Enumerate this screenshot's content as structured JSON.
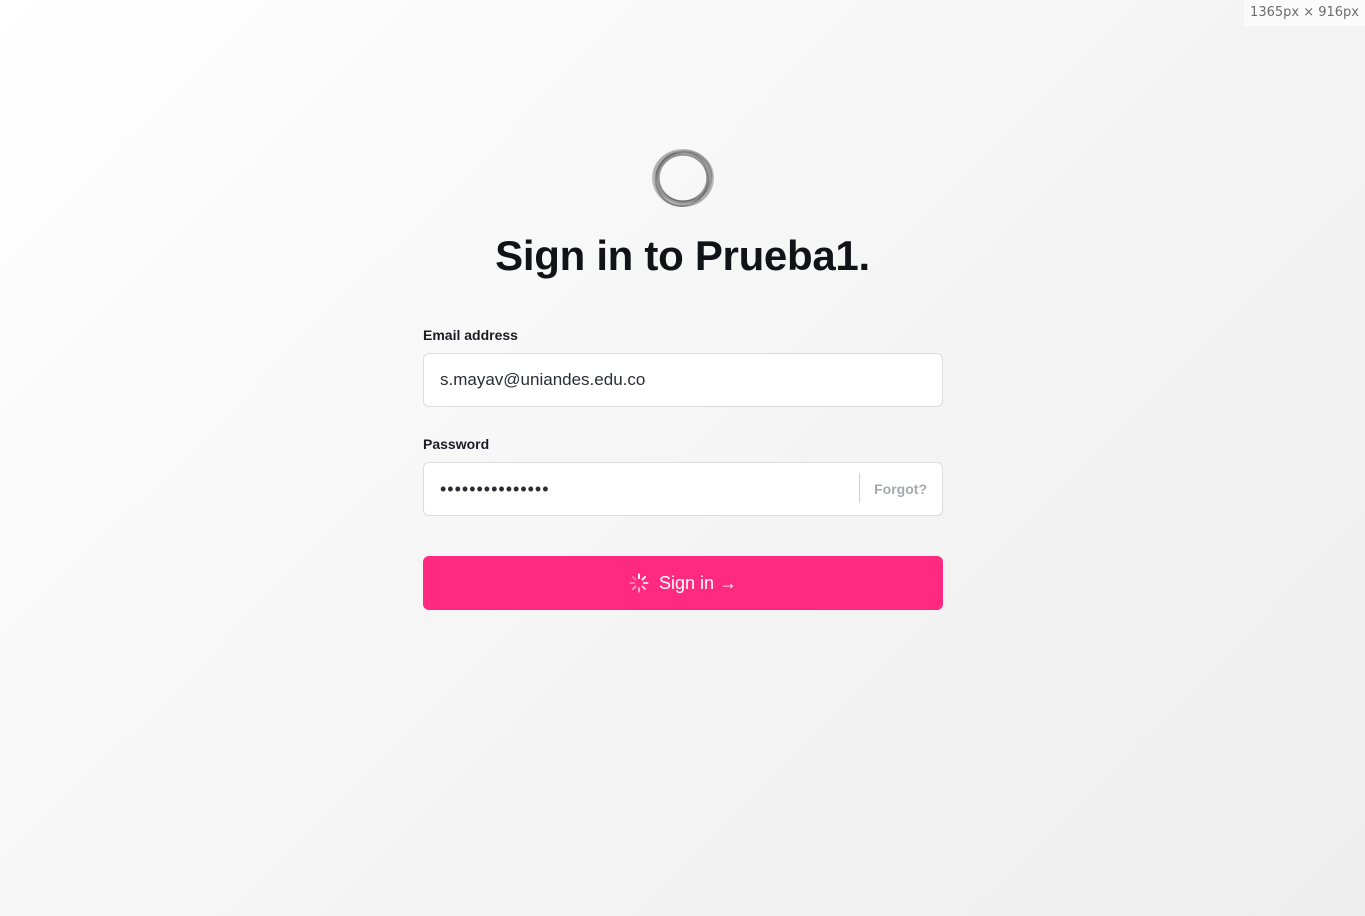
{
  "viewport_indicator": "1365px × 916px",
  "logo": {
    "icon": "ring-logo-icon"
  },
  "title": "Sign in to Prueba1.",
  "form": {
    "email": {
      "label": "Email address",
      "value": "s.mayav@uniandes.edu.co"
    },
    "password": {
      "label": "Password",
      "masked_value": "•••••••••••••••",
      "forgot_label": "Forgot?"
    },
    "submit": {
      "label": "Sign in →",
      "state_icon": "loading-spinner-icon"
    }
  },
  "colors": {
    "accent": "#ff2a7f",
    "text": "#111317",
    "muted": "#a5a8ae",
    "border": "#dcdde0"
  }
}
